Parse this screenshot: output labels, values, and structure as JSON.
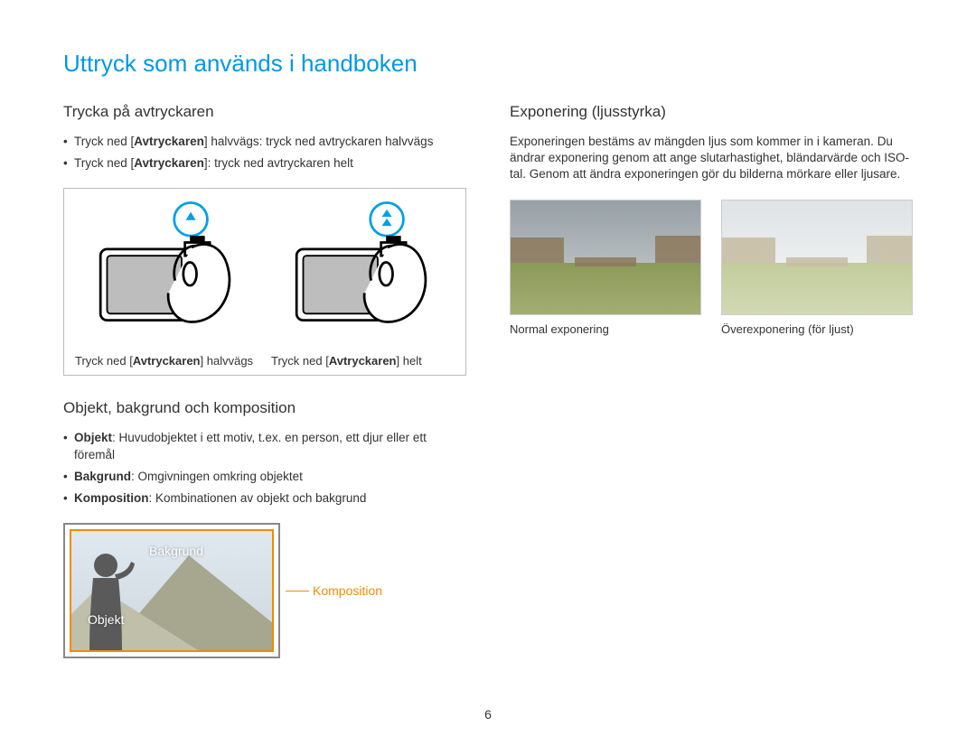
{
  "title": "Uttryck som används i handboken",
  "left": {
    "shutter": {
      "heading": "Trycka på avtryckaren",
      "bullet1_pre": "Tryck ned [",
      "bullet1_bold": "Avtryckaren",
      "bullet1_post": "] halvvägs: tryck ned avtryckaren halvvägs",
      "bullet2_pre": "Tryck ned [",
      "bullet2_bold": "Avtryckaren",
      "bullet2_post": "]: tryck ned avtryckaren helt",
      "cap1_pre": "Tryck ned [",
      "cap1_bold": "Avtryckaren",
      "cap1_post": "] halvvägs",
      "cap2_pre": "Tryck ned [",
      "cap2_bold": "Avtryckaren",
      "cap2_post": "] helt"
    },
    "composition": {
      "heading": "Objekt, bakgrund och komposition",
      "b1_bold": "Objekt",
      "b1_rest": ": Huvudobjektet i ett motiv, t.ex. en person, ett djur eller ett föremål",
      "b2_bold": "Bakgrund",
      "b2_rest": ": Omgivningen omkring objektet",
      "b3_bold": "Komposition",
      "b3_rest": ": Kombinationen av objekt och bakgrund",
      "label_bg": "Bakgrund",
      "label_obj": "Objekt",
      "label_comp": "Komposition"
    }
  },
  "right": {
    "exposure": {
      "heading": "Exponering (ljusstyrka)",
      "body": "Exponeringen bestäms av mängden ljus som kommer in i kameran. Du ändrar exponering genom att ange slutarhastighet, bländarvärde och ISO-tal. Genom att ändra exponeringen gör du bilderna mörkare eller ljusare.",
      "cap_normal": "Normal exponering",
      "cap_over": "Överexponering (för ljust)"
    }
  },
  "page_number": "6"
}
